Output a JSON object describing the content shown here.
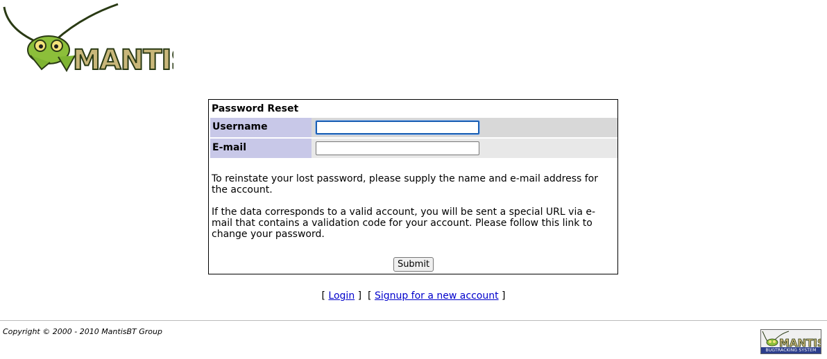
{
  "header": {
    "logo_text": "MANTIS"
  },
  "form": {
    "title": "Password Reset",
    "username_label": "Username",
    "username_value": "",
    "email_label": "E-mail",
    "email_value": "",
    "info_paragraph_1": "To reinstate your lost password, please supply the name and e-mail address for the account.",
    "info_paragraph_2": "If the data corresponds to a valid account, you will be sent a special URL via e-mail that contains a validation code for your account. Please follow this link to change your password.",
    "submit_label": "Submit"
  },
  "links": {
    "open_bracket": "[ ",
    "login_label": "Login",
    "separator": " ]  [ ",
    "signup_label": "Signup for a new account",
    "close_bracket": " ]"
  },
  "footer": {
    "copyright": "Copyright © 2000 - 2010 MantisBT Group",
    "badge_logo_text": "MANTIS",
    "badge_caption": "BUGTRACKING SYSTEM"
  },
  "colors": {
    "label_cell_bg": "#c8c8e8",
    "row1_bg": "#d8d8d8",
    "row2_bg": "#e8e8e8",
    "link": "#0000cc",
    "logo_green": "#6a9a2a"
  }
}
